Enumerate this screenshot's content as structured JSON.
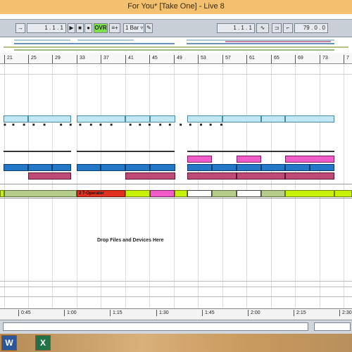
{
  "window": {
    "title": "For You*  [Take One] - Live 8"
  },
  "transport": {
    "follow_icon": "arrow-right-icon",
    "position": "1 . 1 . 1",
    "ovr_label": "OVR",
    "quantize": "1 Bar",
    "loop_start": "1 . 1 . 1",
    "tempo": "79 . 0 . 0"
  },
  "ruler": {
    "bars": [
      "21",
      "25",
      "29",
      "33",
      "37",
      "41",
      "45",
      "49",
      "53",
      "57",
      "61",
      "65",
      "69",
      "73",
      "7"
    ]
  },
  "arrangement": {
    "clip_label": "2 7-Operator",
    "drop_hint": "Drop Files and Devices Here"
  },
  "time_ruler": {
    "labels": [
      "0:45",
      "1:00",
      "1:15",
      "1:30",
      "1:45",
      "2:00",
      "2:15",
      "2:30"
    ]
  },
  "taskbar": {
    "word_label": "W",
    "excel_label": "X"
  },
  "colors": {
    "title_bar": "#f3c070",
    "clip_cyan": "#bfe8f4",
    "clip_blue": "#2277c7",
    "clip_pink": "#f25cc8",
    "clip_plum": "#c04a76",
    "clip_lime": "#c6f008",
    "clip_sage": "#b6cc8a",
    "clip_red": "#e03020"
  }
}
